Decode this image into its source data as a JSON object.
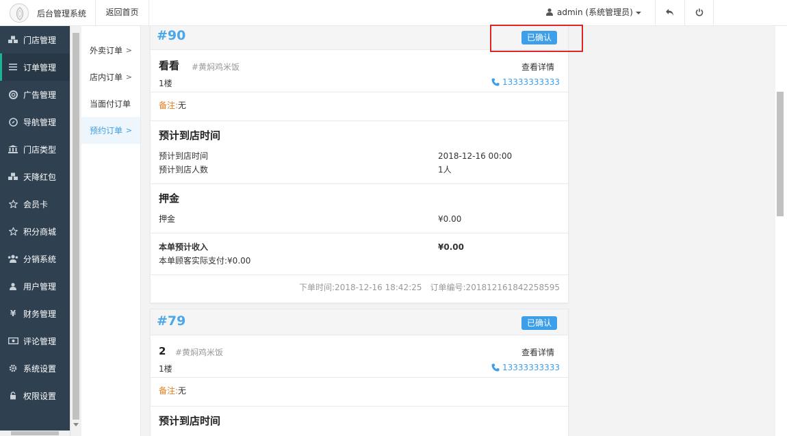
{
  "header": {
    "app_title": "后台管理系统",
    "back_home": "返回首页",
    "user": "admin (系统管理员)"
  },
  "sidebar": {
    "items": [
      {
        "label": "门店管理",
        "icon": "cubes-icon"
      },
      {
        "label": "订单管理",
        "icon": "list-icon",
        "active": true
      },
      {
        "label": "广告管理",
        "icon": "life-ring-icon"
      },
      {
        "label": "导航管理",
        "icon": "compass-icon"
      },
      {
        "label": "门店类型",
        "icon": "bank-icon"
      },
      {
        "label": "天降红包",
        "icon": "cubes-icon"
      },
      {
        "label": "会员卡",
        "icon": "star-icon"
      },
      {
        "label": "积分商城",
        "icon": "star-icon"
      },
      {
        "label": "分销系统",
        "icon": "users-icon"
      },
      {
        "label": "用户管理",
        "icon": "user-icon"
      },
      {
        "label": "财务管理",
        "icon": "yen-icon"
      },
      {
        "label": "评论管理",
        "icon": "money-icon"
      },
      {
        "label": "系统设置",
        "icon": "gear-icon"
      },
      {
        "label": "权限设置",
        "icon": "lock-icon"
      }
    ]
  },
  "submenu": {
    "items": [
      {
        "label": "外卖订单",
        "chevron": true
      },
      {
        "label": "店内订单",
        "chevron": true
      },
      {
        "label": "当面付订单",
        "chevron": false
      },
      {
        "label": "预约订单",
        "chevron": true,
        "active": true
      }
    ]
  },
  "orders": [
    {
      "number": "#90",
      "status": "已确认",
      "customer": "看看",
      "shop": "#黄焖鸡米饭",
      "floor": "1楼",
      "detail_link": "查看详情",
      "phone": "13333333333",
      "remark_label": "备注:",
      "remark_value": "无",
      "arrival_title": "预计到店时间",
      "arrival_time_label": "预计到店时间",
      "arrival_time_value": "2018-12-16 00:00",
      "arrival_people_label": "预计到店人数",
      "arrival_people_value": "1人",
      "deposit_title": "押金",
      "deposit_label": "押金",
      "deposit_value": "¥0.00",
      "income_label": "本单预计收入",
      "income_value": "¥0.00",
      "paid_text": "本单顾客实际支付:¥0.00",
      "order_time": "下单时间:2018-12-16 18:42:25",
      "order_code": "订单编号:201812161842258595"
    },
    {
      "number": "#79",
      "status": "已确认",
      "customer": "2",
      "shop": "#黄焖鸡米饭",
      "floor": "1楼",
      "detail_link": "查看详情",
      "phone": "13333333333",
      "remark_label": "备注:",
      "remark_value": "无",
      "arrival_title": "预计到店时间"
    }
  ],
  "colors": {
    "accent": "#3d9ee9",
    "sidebar_bg": "#2f4050",
    "highlight_box": "#e02424",
    "remark_label": "#e67e22"
  }
}
